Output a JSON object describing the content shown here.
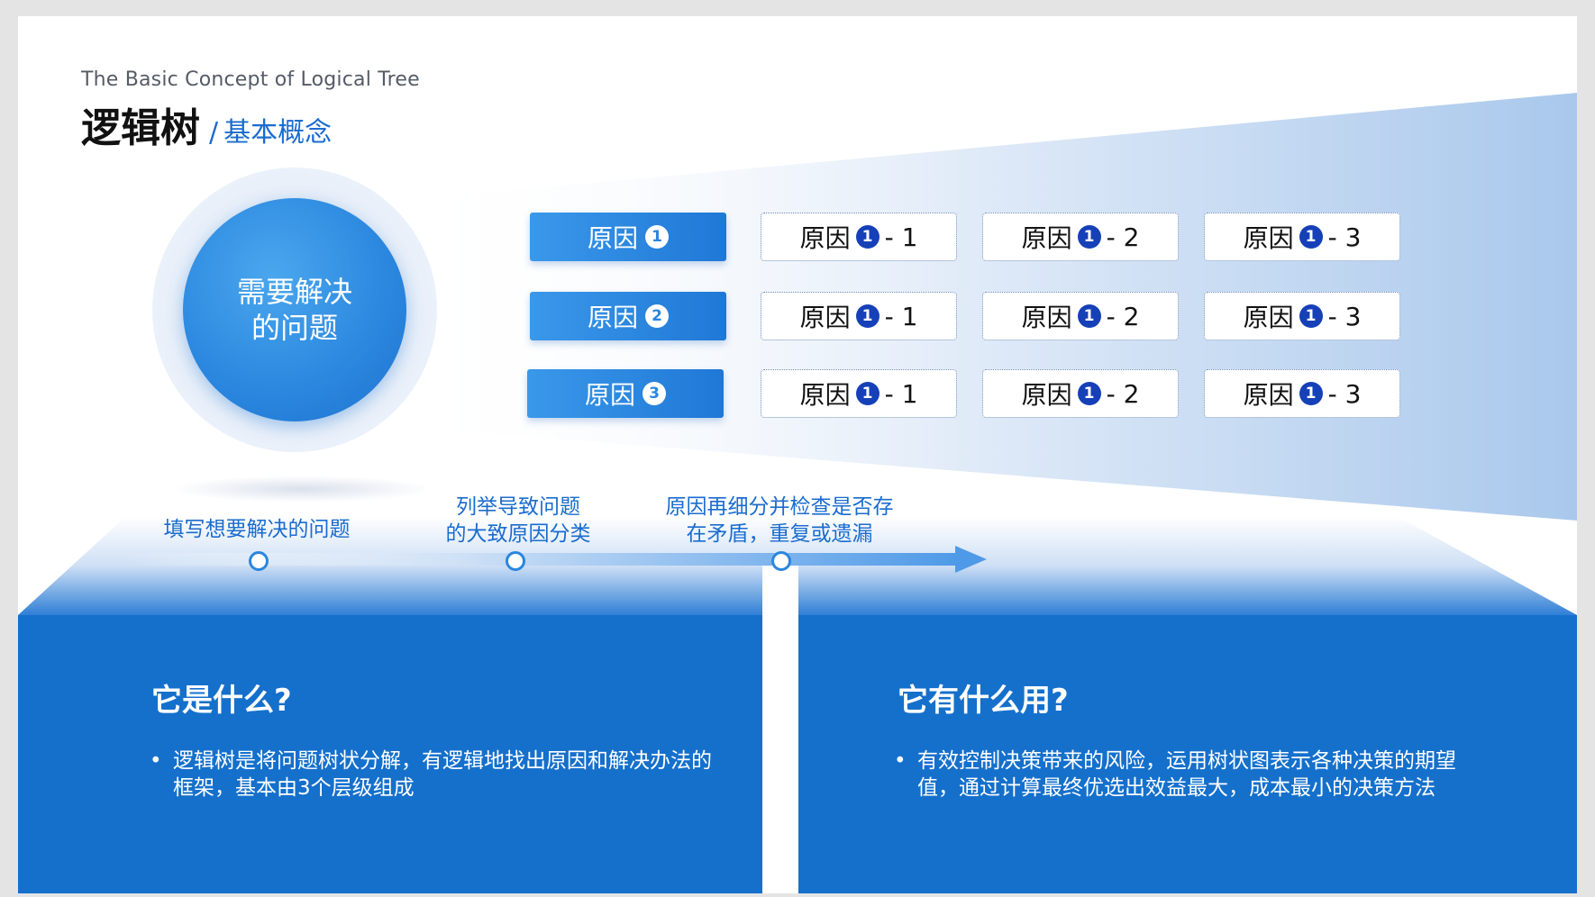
{
  "header": {
    "subtitle_en": "The Basic Concept of Logical Tree",
    "title": "逻辑树",
    "separator": "/",
    "title_sub": "基本概念"
  },
  "problem": {
    "text": "需要解决的问题"
  },
  "causes": [
    {
      "label": "原因",
      "number": "1",
      "subs": [
        {
          "label": "原因",
          "number": "1",
          "suffix": "- 1"
        },
        {
          "label": "原因",
          "number": "1",
          "suffix": "- 2"
        },
        {
          "label": "原因",
          "number": "1",
          "suffix": "- 3"
        }
      ]
    },
    {
      "label": "原因",
      "number": "2",
      "subs": [
        {
          "label": "原因",
          "number": "1",
          "suffix": "- 1"
        },
        {
          "label": "原因",
          "number": "1",
          "suffix": "- 2"
        },
        {
          "label": "原因",
          "number": "1",
          "suffix": "- 3"
        }
      ]
    },
    {
      "label": "原因",
      "number": "3",
      "subs": [
        {
          "label": "原因",
          "number": "1",
          "suffix": "- 1"
        },
        {
          "label": "原因",
          "number": "1",
          "suffix": "- 2"
        },
        {
          "label": "原因",
          "number": "1",
          "suffix": "- 3"
        }
      ]
    }
  ],
  "steps": [
    {
      "line1": "填写想要解决的问题",
      "line2": ""
    },
    {
      "line1": "列举导致问题",
      "line2": "的大致原因分类"
    },
    {
      "line1": "原因再细分并检查是否存",
      "line2": "在矛盾，重复或遗漏"
    }
  ],
  "panels": {
    "left": {
      "title": "它是什么?",
      "bullet": "•",
      "body": "逻辑树是将问题树状分解，有逻辑地找出原因和解决办法的框架，基本由3个层级组成"
    },
    "right": {
      "title": "它有什么用?",
      "bullet": "•",
      "body": "有效控制决策带来的风险，运用树状图表示各种决策的期望值，通过计算最终优选出效益最大，成本最小的决策方法"
    }
  },
  "colors": {
    "accent": "#1a6ccf",
    "panel": "#1570cc",
    "badge_dark": "#1640b8"
  }
}
